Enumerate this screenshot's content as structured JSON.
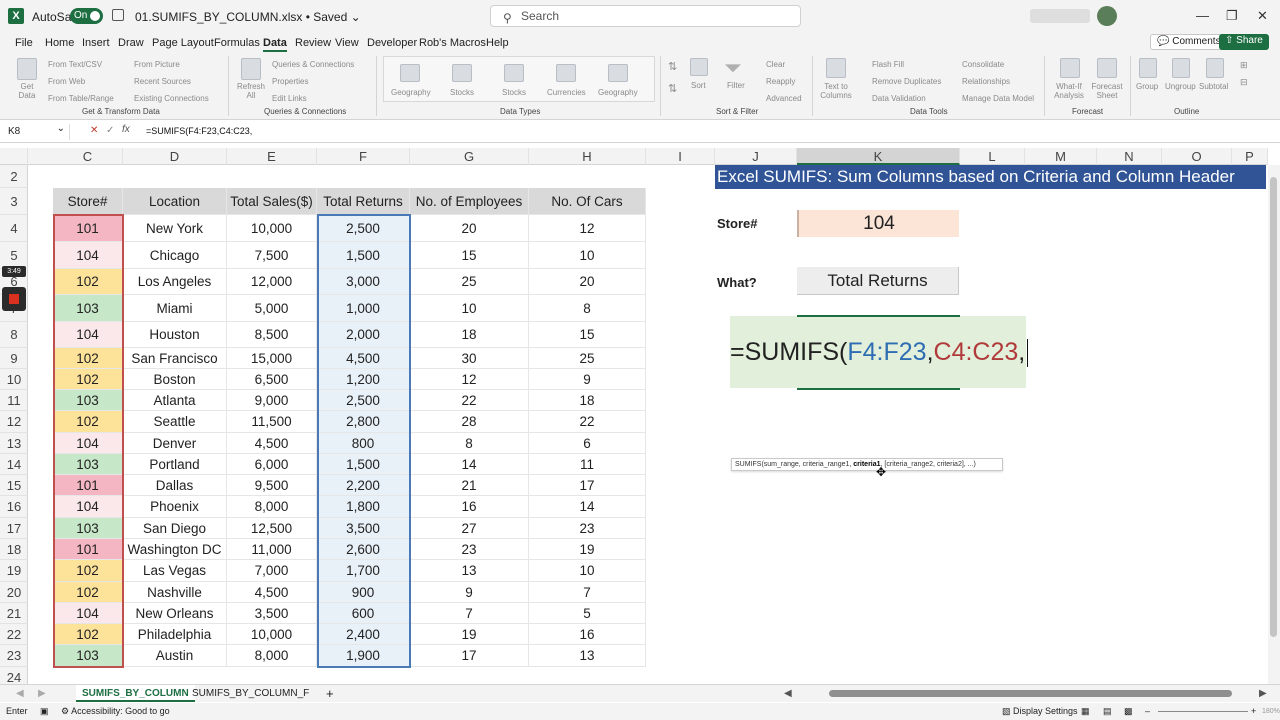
{
  "title_bar": {
    "app_icon": "excel-logo",
    "autosave_label": "AutoSave",
    "autosave_state": "On",
    "file_name": "01.SUMIFS_BY_COLUMN.xlsx • Saved ⌄",
    "search_placeholder": "Search",
    "search_icon": "search-icon",
    "minimize": "—",
    "restore": "❐",
    "close": "✕"
  },
  "menu": {
    "tabs": [
      "File",
      "Home",
      "Insert",
      "Draw",
      "Page Layout",
      "Formulas",
      "Data",
      "Review",
      "View",
      "Developer",
      "Rob's Macros",
      "Help"
    ],
    "active_tab": "Data",
    "comments": "Comments",
    "share": "Share"
  },
  "ribbon": {
    "get_data": "Get Data",
    "get_transform_items": [
      "From Text/CSV",
      "From Web",
      "From Table/Range",
      "From Picture",
      "Recent Sources",
      "Existing Connections"
    ],
    "get_transform_label": "Get & Transform Data",
    "refresh": "Refresh All",
    "queries_items": [
      "Queries & Connections",
      "Properties",
      "Edit Links"
    ],
    "queries_label": "Queries & Connections",
    "data_types": [
      "Geography",
      "Stocks",
      "Stocks",
      "Currencies",
      "Geography"
    ],
    "data_types_label": "Data Types",
    "sort": "Sort",
    "filter": "Filter",
    "filter_items": [
      "Clear",
      "Reapply",
      "Advanced"
    ],
    "sort_filter_label": "Sort & Filter",
    "text_to_columns": "Text to Columns",
    "data_tools_items": [
      "Flash Fill",
      "Remove Duplicates",
      "Data Validation",
      "Consolidate",
      "Relationships",
      "Manage Data Model"
    ],
    "data_tools_label": "Data Tools",
    "what_if": "What-If Analysis",
    "forecast_sheet": "Forecast Sheet",
    "forecast_label": "Forecast",
    "group": "Group",
    "ungroup": "Ungroup",
    "subtotal": "Subtotal",
    "outline_label": "Outline"
  },
  "formula_bar": {
    "name_box": "K8",
    "fx": "fx",
    "formula": "=SUMIFS(F4:F23,C4:C23,"
  },
  "columns": [
    "C",
    "D",
    "E",
    "F",
    "G",
    "H",
    "I",
    "J",
    "K",
    "L",
    "M",
    "N",
    "O",
    "P"
  ],
  "selected_column": "K",
  "rows": [
    "2",
    "3",
    "4",
    "5",
    "6",
    "7",
    "8",
    "9",
    "10",
    "11",
    "12",
    "13",
    "14",
    "15",
    "16",
    "17",
    "18",
    "19",
    "20",
    "21",
    "22",
    "23",
    "24"
  ],
  "table": {
    "headers": [
      "Store#",
      "Location",
      "Total Sales($)",
      "Total Returns",
      "No. of Employees",
      "No. Of Cars"
    ],
    "rows": [
      [
        "101",
        "New York",
        "10,000",
        "2,500",
        "20",
        "12"
      ],
      [
        "104",
        "Chicago",
        "7,500",
        "1,500",
        "15",
        "10"
      ],
      [
        "102",
        "Los Angeles",
        "12,000",
        "3,000",
        "25",
        "20"
      ],
      [
        "103",
        "Miami",
        "5,000",
        "1,000",
        "10",
        "8"
      ],
      [
        "104",
        "Houston",
        "8,500",
        "2,000",
        "18",
        "15"
      ],
      [
        "102",
        "San Francisco",
        "15,000",
        "4,500",
        "30",
        "25"
      ],
      [
        "102",
        "Boston",
        "6,500",
        "1,200",
        "12",
        "9"
      ],
      [
        "103",
        "Atlanta",
        "9,000",
        "2,500",
        "22",
        "18"
      ],
      [
        "102",
        "Seattle",
        "11,500",
        "2,800",
        "28",
        "22"
      ],
      [
        "104",
        "Denver",
        "4,500",
        "800",
        "8",
        "6"
      ],
      [
        "103",
        "Portland",
        "6,000",
        "1,500",
        "14",
        "11"
      ],
      [
        "101",
        "Dallas",
        "9,500",
        "2,200",
        "21",
        "17"
      ],
      [
        "104",
        "Phoenix",
        "8,000",
        "1,800",
        "16",
        "14"
      ],
      [
        "103",
        "San Diego",
        "12,500",
        "3,500",
        "27",
        "23"
      ],
      [
        "101",
        "Washington DC",
        "11,000",
        "2,600",
        "23",
        "19"
      ],
      [
        "102",
        "Las Vegas",
        "7,000",
        "1,700",
        "13",
        "10"
      ],
      [
        "102",
        "Nashville",
        "4,500",
        "900",
        "9",
        "7"
      ],
      [
        "104",
        "New Orleans",
        "3,500",
        "600",
        "7",
        "5"
      ],
      [
        "102",
        "Philadelphia",
        "10,000",
        "2,400",
        "19",
        "16"
      ],
      [
        "103",
        "Austin",
        "8,000",
        "1,900",
        "17",
        "13"
      ]
    ],
    "store_colors": {
      "101": "#f4b6c2",
      "102": "#fde29a",
      "103": "#c6e7c8",
      "104": "#fbe8ea"
    }
  },
  "panel": {
    "banner": "Excel SUMIFS: Sum  Columns based on Criteria and Column Header",
    "store_label": "Store#",
    "store_value": "104",
    "what_label": "What?",
    "what_value": "Total Returns",
    "formula_prefix": "=SUMIFS(",
    "formula_ref1": "F4:F23",
    "formula_comma1": ",",
    "formula_ref2": "C4:C23",
    "formula_comma2": ",",
    "tooltip_pre": "SUMIFS(sum_range, criteria_range1, ",
    "tooltip_bold": "criteria1",
    "tooltip_post": ", [criteria_range2, criteria2], ...)"
  },
  "sheet_tabs": [
    "SUMIFS_BY_COLUMN",
    "SUMIFS_BY_COLUMN_F"
  ],
  "active_sheet": "SUMIFS_BY_COLUMN",
  "add_sheet": "+",
  "status": {
    "mode": "Enter",
    "accessibility": "Accessibility: Good to go",
    "display_settings": "Display Settings",
    "zoom": "180%"
  },
  "recorder": {
    "time": "3:49"
  }
}
